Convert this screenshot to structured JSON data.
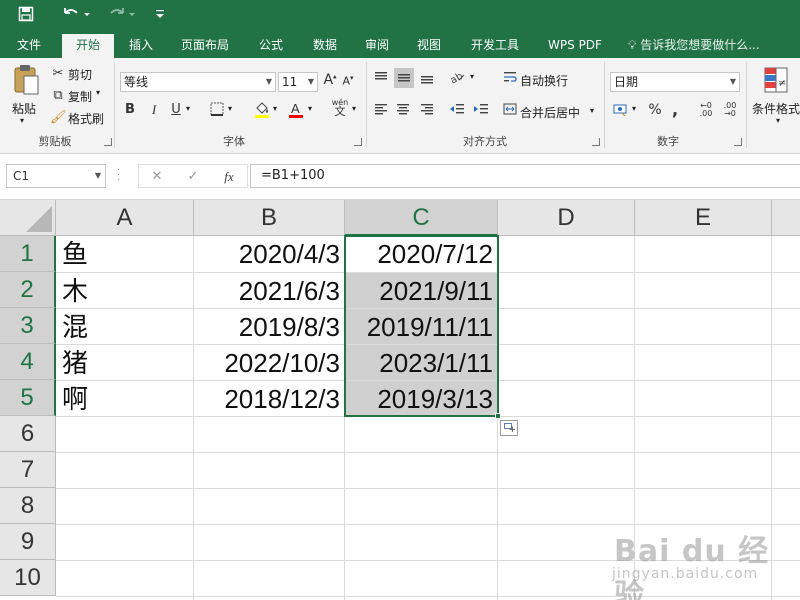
{
  "ribbon_tabs": [
    "文件",
    "开始",
    "插入",
    "页面布局",
    "公式",
    "数据",
    "审阅",
    "视图",
    "开发工具",
    "WPS PDF"
  ],
  "active_tab": "开始",
  "tell_me": "告诉我您想要做什么...",
  "clipboard": {
    "paste_label": "粘贴",
    "cut_label": "剪切",
    "copy_label": "复制",
    "format_painter_label": "格式刷",
    "group_label": "剪贴板"
  },
  "font": {
    "font_name": "等线",
    "font_size": "11",
    "bold": "B",
    "italic": "I",
    "underline": "U",
    "phonetic_top": "wén",
    "phonetic_bottom": "文",
    "group_label": "字体",
    "highlight_color": "#FFFF00",
    "font_color": "#FF0000"
  },
  "alignment": {
    "wrap_text_label": "自动换行",
    "merge_center_label": "合并后居中",
    "group_label": "对齐方式"
  },
  "number": {
    "format": "日期",
    "percent": "%",
    "comma": ",",
    "group_label": "数字"
  },
  "styles": {
    "conditional_format_label": "条件格式"
  },
  "formula_bar": {
    "name_box": "C1",
    "fx_label": "fx",
    "formula": "=B1+100"
  },
  "columns": [
    "A",
    "B",
    "C",
    "D",
    "E"
  ],
  "selected_column": "C",
  "rows": [
    {
      "num": "1",
      "a": "鱼",
      "b": "2020/4/3",
      "c": "2020/7/12"
    },
    {
      "num": "2",
      "a": "木",
      "b": "2021/6/3",
      "c": "2021/9/11"
    },
    {
      "num": "3",
      "a": "混",
      "b": "2019/8/3",
      "c": "2019/11/11"
    },
    {
      "num": "4",
      "a": "猪",
      "b": "2022/10/3",
      "c": "2023/1/11"
    },
    {
      "num": "5",
      "a": "啊",
      "b": "2018/12/3",
      "c": "2019/3/13"
    }
  ],
  "empty_rows": [
    "6",
    "7",
    "8",
    "9",
    "10"
  ],
  "accent_color": "#217346",
  "watermark": {
    "main": "Bai du 经验",
    "sub": "jingyan.baidu.com"
  }
}
